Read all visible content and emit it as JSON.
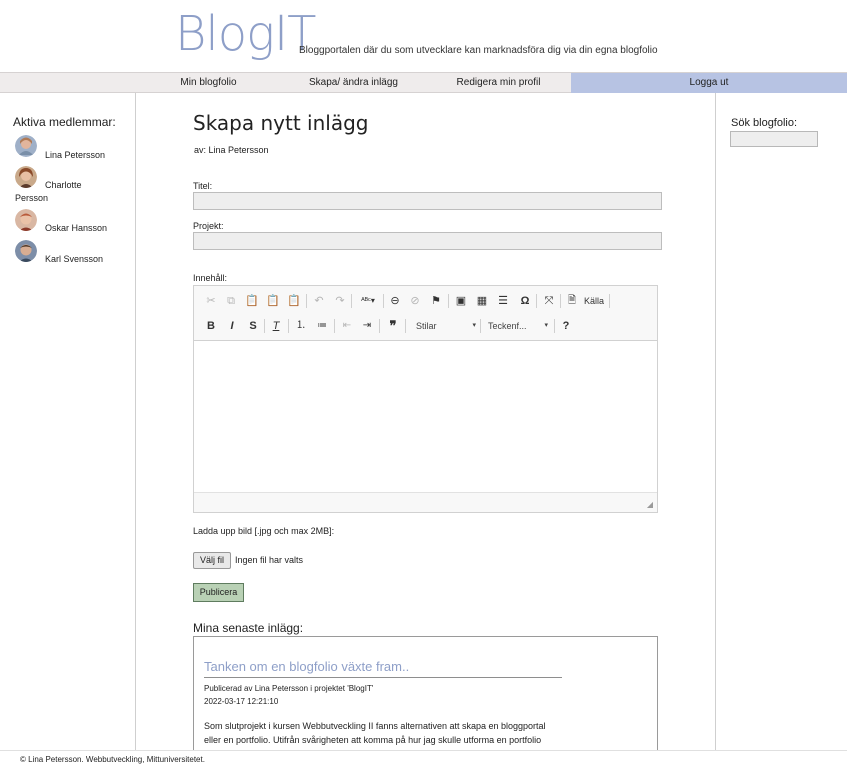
{
  "header": {
    "logo": "BlogIT",
    "tagline": "Bloggportalen där du som utvecklare kan marknadsföra dig via din egna blogfolio"
  },
  "nav": {
    "items": [
      "Min blogfolio",
      "Skapa/ ändra inlägg",
      "Redigera min profil",
      "Logga ut"
    ]
  },
  "sidebar": {
    "title": "Aktiva medlemmar:",
    "members": [
      {
        "name": "Lina Petersson"
      },
      {
        "name": "Charlotte",
        "name2": "Persson"
      },
      {
        "name": "Oskar Hansson"
      },
      {
        "name": "Karl Svensson"
      }
    ]
  },
  "search": {
    "label": "Sök blogfolio:",
    "value": ""
  },
  "form": {
    "title": "Skapa nytt inlägg",
    "author": "av: Lina Petersson",
    "title_label": "Titel:",
    "title_value": "",
    "project_label": "Projekt:",
    "project_value": "",
    "content_label": "Innehåll:",
    "upload_label": "Ladda upp bild [.jpg och max 2MB]:",
    "file_button": "Välj fil",
    "file_status": "Ingen fil har valts",
    "publish_button": "Publicera"
  },
  "editor": {
    "source_label": "Källa",
    "styles_label": "Stilar",
    "format_label": "Teckenf..."
  },
  "recent": {
    "title": "Mina senaste inlägg:",
    "post_title": "Tanken om en blogfolio växte fram..",
    "post_meta": "Publicerad av Lina Petersson i projektet 'BlogIT'",
    "post_date": "2022-03-17 12:21:10",
    "post_body_1": "Som slutprojekt i kursen Webbutveckling II fanns alternativen att skapa en bloggportal",
    "post_body_2": "eller en portfolio. Utifrån svårigheten att komma på hur jag skulle utforma en portfolio"
  },
  "footer": {
    "text": "© Lina Petersson. Webbutveckling, Mittuniversitetet."
  },
  "colors": {
    "accent": "#8e9fc8",
    "nav_bg": "#efecec",
    "logout_bg": "#b7c3e3",
    "publish_bg": "#b9d1b5"
  }
}
